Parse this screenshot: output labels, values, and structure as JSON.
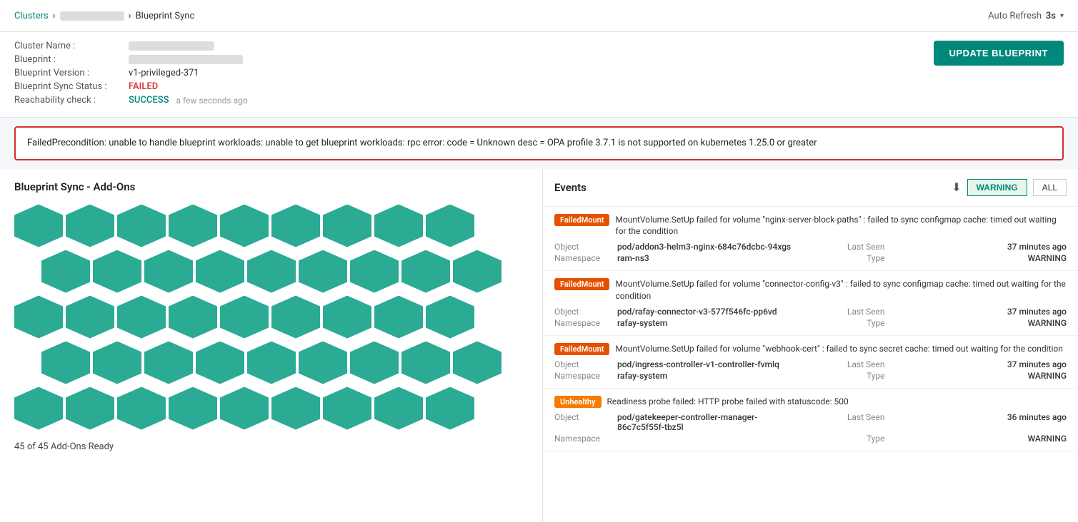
{
  "breadcrumb": {
    "clusters_label": "Clusters",
    "cluster_name": "███████████",
    "separator": "›",
    "page": "Blueprint Sync"
  },
  "auto_refresh": {
    "label": "Auto Refresh",
    "value": "3s",
    "chevron": "▾"
  },
  "info": {
    "cluster_name_label": "Cluster Name :",
    "cluster_name_value": "",
    "blueprint_label": "Blueprint :",
    "blueprint_value": "",
    "blueprint_version_label": "Blueprint Version :",
    "blueprint_version_value": "v1-privileged-371",
    "sync_status_label": "Blueprint Sync Status :",
    "sync_status_value": "FAILED",
    "reachability_label": "Reachability check :",
    "reachability_value": "SUCCESS",
    "reachability_time": "a few seconds ago"
  },
  "update_button": "UPDATE BLUEPRINT",
  "error_message": "FailedPrecondition: unable to handle blueprint workloads: unable to get blueprint workloads: rpc error: code = Unknown desc = OPA profile 3.7.1 is not supported on kubernetes 1.25.0 or greater",
  "left_panel": {
    "title": "Blueprint Sync - Add-Ons",
    "addons_count": "45 of 45 Add-Ons Ready",
    "hex_rows": [
      {
        "offset": false,
        "count": 9
      },
      {
        "offset": true,
        "count": 9
      },
      {
        "offset": false,
        "count": 9
      },
      {
        "offset": true,
        "count": 9
      },
      {
        "offset": false,
        "count": 9
      }
    ]
  },
  "events": {
    "title": "Events",
    "filter_warning": "WARNING",
    "filter_all": "ALL",
    "items": [
      {
        "tag": "FailedMount",
        "tag_type": "failed-mount",
        "message": "MountVolume.SetUp failed for volume \"nginx-server-block-paths\" : failed to sync configmap cache: timed out waiting for the condition",
        "object_label": "Object",
        "object_value": "pod/addon3-helm3-nginx-684c76dcbc-94xgs",
        "namespace_label": "Namespace",
        "namespace_value": "ram-ns3",
        "last_seen_label": "Last Seen",
        "last_seen_value": "37 minutes ago",
        "type_label": "Type",
        "type_value": "WARNING"
      },
      {
        "tag": "FailedMount",
        "tag_type": "failed-mount",
        "message": "MountVolume.SetUp failed for volume \"connector-config-v3\" : failed to sync configmap cache: timed out waiting for the condition",
        "object_label": "Object",
        "object_value": "pod/rafay-connector-v3-577f546fc-pp6vd",
        "namespace_label": "Namespace",
        "namespace_value": "rafay-system",
        "last_seen_label": "Last Seen",
        "last_seen_value": "37 minutes ago",
        "type_label": "Type",
        "type_value": "WARNING"
      },
      {
        "tag": "FailedMount",
        "tag_type": "failed-mount",
        "message": "MountVolume.SetUp failed for volume \"webhook-cert\" : failed to sync secret cache: timed out waiting for the condition",
        "object_label": "Object",
        "object_value": "pod/ingress-controller-v1-controller-fvmlq",
        "namespace_label": "Namespace",
        "namespace_value": "rafay-system",
        "last_seen_label": "Last Seen",
        "last_seen_value": "37 minutes ago",
        "type_label": "Type",
        "type_value": "WARNING"
      },
      {
        "tag": "Unhealthy",
        "tag_type": "unhealthy",
        "message": "Readiness probe failed: HTTP probe failed with statuscode: 500",
        "object_label": "Object",
        "object_value": "pod/gatekeeper-controller-manager-86c7c5f55f-tbz5l",
        "namespace_label": "Namespace",
        "namespace_value": "",
        "last_seen_label": "Last Seen",
        "last_seen_value": "36 minutes ago",
        "type_label": "Type",
        "type_value": "WARNING"
      }
    ]
  },
  "colors": {
    "teal": "#2baa94",
    "failed_red": "#d32f2f",
    "success_green": "#00897b"
  }
}
